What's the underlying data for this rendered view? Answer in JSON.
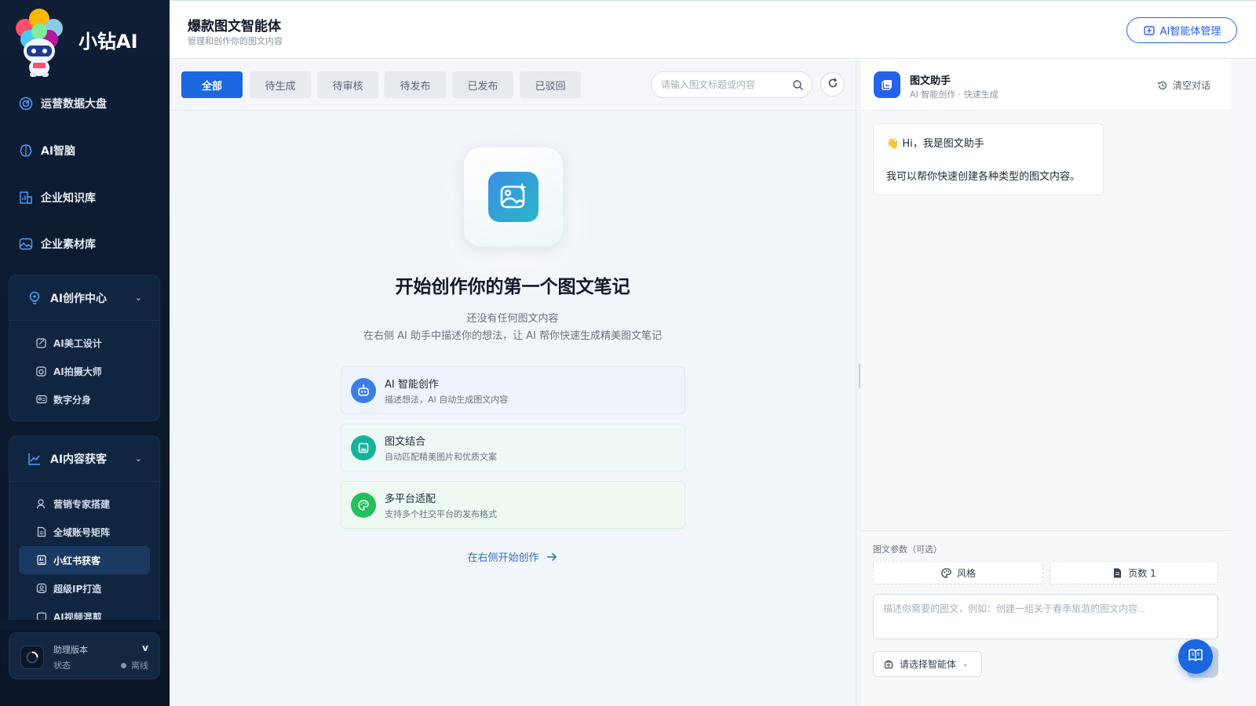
{
  "app": {
    "name": "小钻AI",
    "mascot_badge": "小钻AI"
  },
  "sidebar": {
    "items": [
      {
        "label": "运营数据大盘",
        "icon": "dashboard-icon"
      },
      {
        "label": "AI智脑",
        "icon": "brain-icon"
      },
      {
        "label": "企业知识库",
        "icon": "building-chart-icon"
      },
      {
        "label": "企业素材库",
        "icon": "image-icon"
      }
    ],
    "group_creation": {
      "label": "AI创作中心",
      "icon": "bulb-icon",
      "items": [
        {
          "label": "AI美工设计",
          "icon": "design-icon"
        },
        {
          "label": "AI拍摄大师",
          "icon": "camera-icon"
        },
        {
          "label": "数字分身",
          "icon": "id-card-icon"
        }
      ]
    },
    "group_content": {
      "label": "AI内容获客",
      "icon": "trend-icon",
      "items": [
        {
          "label": "营销专家搭建",
          "icon": "user-icon"
        },
        {
          "label": "全域账号矩阵",
          "icon": "document-icon"
        },
        {
          "label": "小红书获客",
          "icon": "ai-doc-icon",
          "active": true
        },
        {
          "label": "超级IP打造",
          "icon": "portrait-icon"
        },
        {
          "label": "AI视频混剪",
          "icon": "video-icon"
        }
      ]
    },
    "user": {
      "version_label": "助理版本",
      "version_value": "v",
      "status_label": "状态",
      "status_value": "离线"
    }
  },
  "header": {
    "title": "爆款图文智能体",
    "subtitle": "管理和创作你的图文内容",
    "agent_manage_label": "AI智能体管理"
  },
  "toolbar": {
    "tabs": [
      "全部",
      "待生成",
      "待审核",
      "待发布",
      "已发布",
      "已驳回"
    ],
    "active_tab": "全部",
    "search_placeholder": "请输入图文标题或内容"
  },
  "empty": {
    "title": "开始创作你的第一个图文笔记",
    "desc1": "还没有任何图文内容",
    "desc2": "在右侧 AI 助手中描述你的想法，让 AI 帮你快速生成精美图文笔记",
    "features": [
      {
        "title": "AI 智能创作",
        "desc": "描述想法，AI 自动生成图文内容",
        "icon": "robot-icon"
      },
      {
        "title": "图文结合",
        "desc": "自动匹配精美图片和优质文案",
        "icon": "picture-icon"
      },
      {
        "title": "多平台适配",
        "desc": "支持多个社交平台的发布格式",
        "icon": "palette-icon"
      }
    ],
    "start_link": "在右侧开始创作"
  },
  "assistant": {
    "name": "图文助手",
    "desc": "AI 智能创作 · 快速生成",
    "clear_label": "清空对话",
    "greeting_emoji": "👋",
    "greeting": "Hi，我是图文助手",
    "message": "我可以帮你快速创建各种类型的图文内容。",
    "params_label": "图文参数（可选）",
    "style_label": "风格",
    "pages_label": "页数 1",
    "prompt_placeholder": "描述你需要的图文，例如：创建一组关于春季旅游的图文内容...",
    "agent_select_label": "请选择智能体"
  },
  "colors": {
    "primary": "#1a67e0",
    "sidebar_bg": "#0f1e35",
    "teal": "#16b39c",
    "green": "#22c05a"
  }
}
